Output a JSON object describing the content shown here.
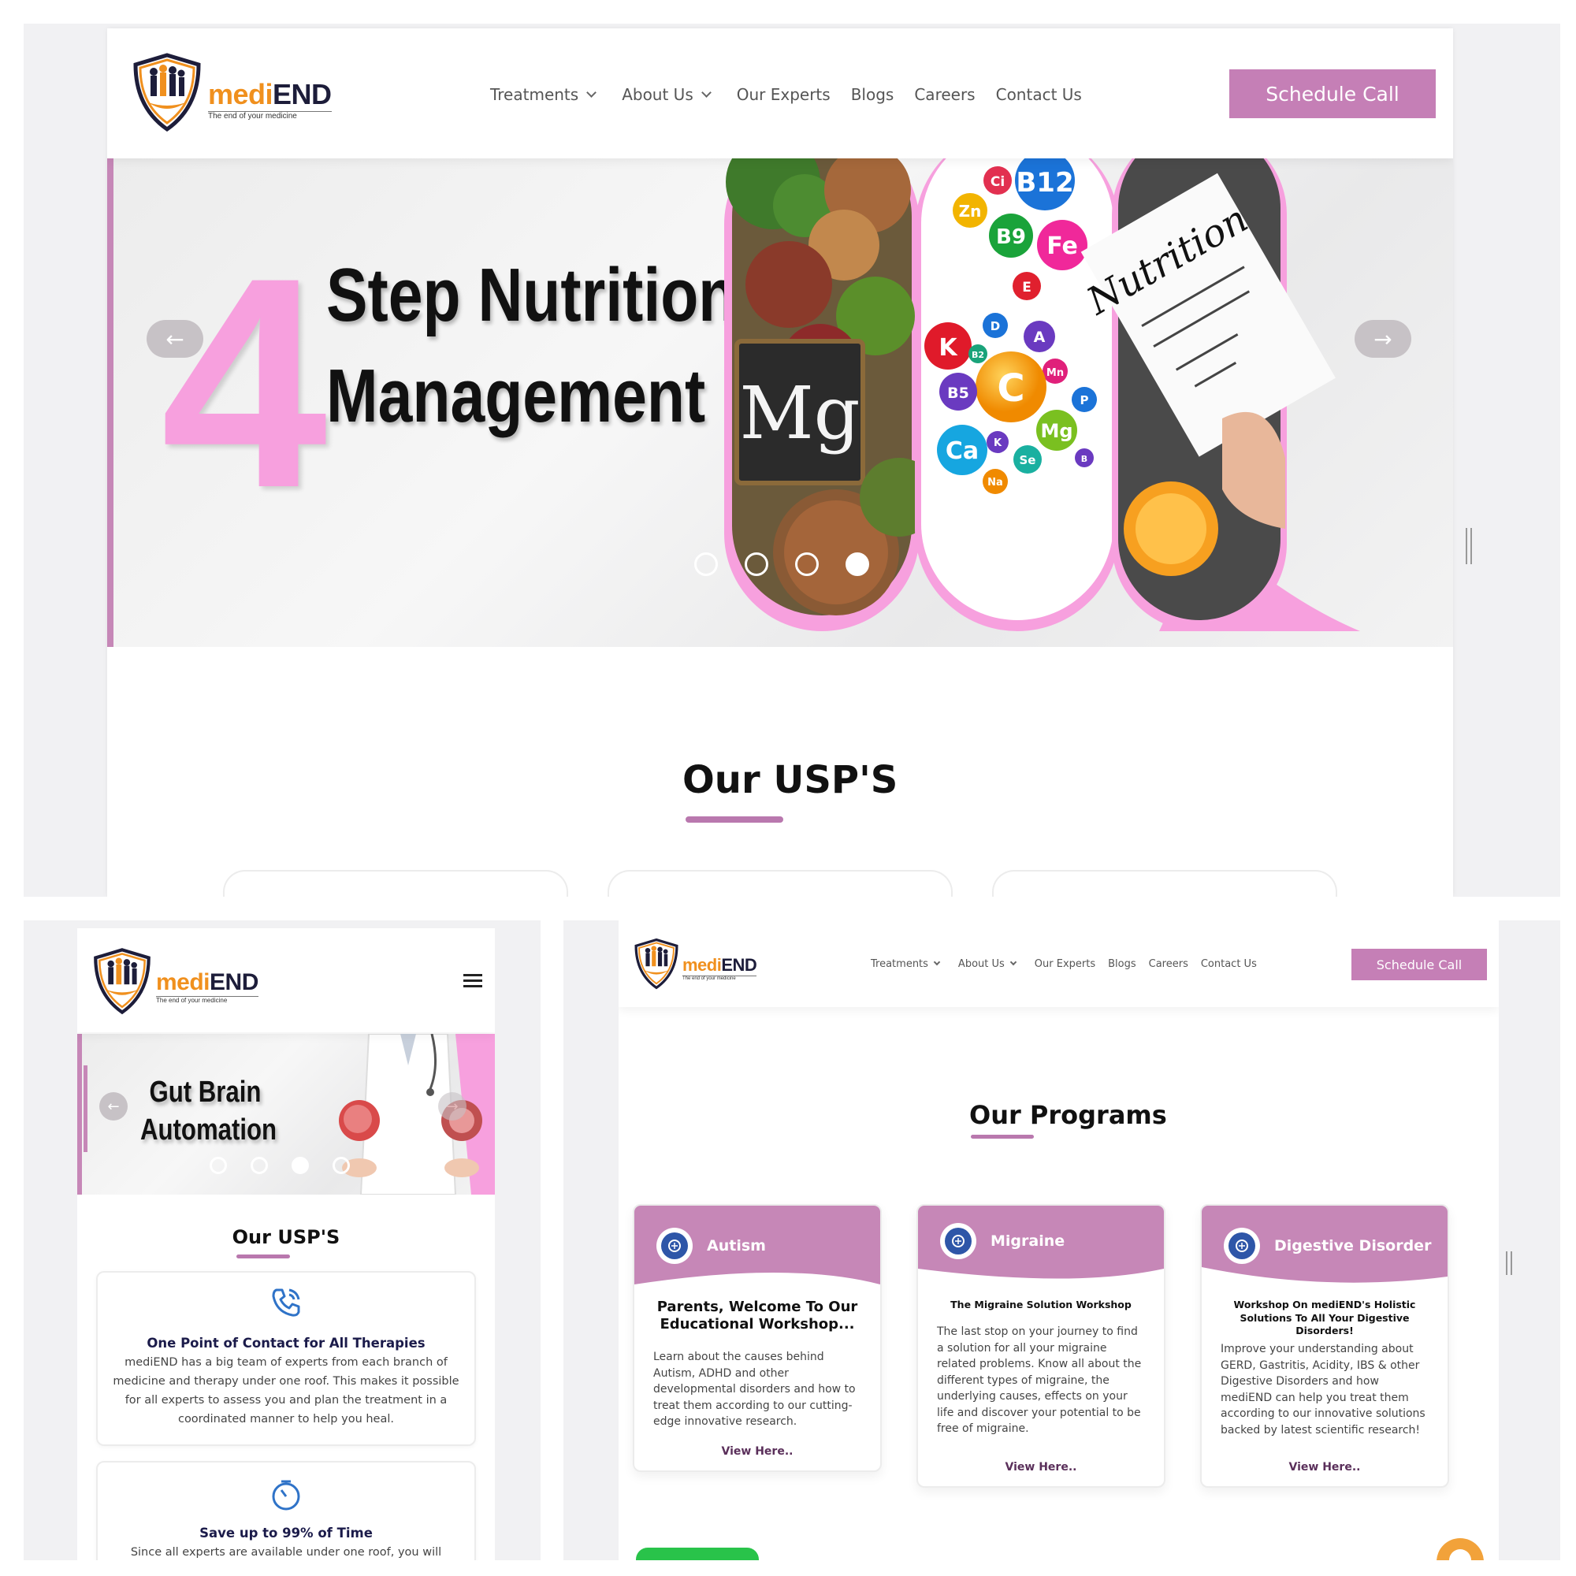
{
  "brand": {
    "medi": "medi",
    "end": "END",
    "tagline": "The end of your medicine"
  },
  "nav": {
    "items": [
      {
        "label": "Treatments",
        "dropdown": true
      },
      {
        "label": "About Us",
        "dropdown": true
      },
      {
        "label": "Our Experts",
        "dropdown": false
      },
      {
        "label": "Blogs",
        "dropdown": false
      },
      {
        "label": "Careers",
        "dropdown": false
      },
      {
        "label": "Contact Us",
        "dropdown": false
      }
    ],
    "cta": "Schedule Call"
  },
  "desktop_hero": {
    "number": "4",
    "title_line1": "Step Nutrition",
    "title_line2": "Management",
    "prev_arrow": "←",
    "next_arrow": "→",
    "slide_count": 4,
    "active_slide": 4,
    "image_text": {
      "chalkboard": "Mg",
      "note": "Nutrition",
      "vitamins": [
        "B12",
        "Ci",
        "Zn",
        "B9",
        "Fe",
        "E",
        "K",
        "D",
        "A",
        "B2",
        "Mn",
        "C",
        "B5",
        "P",
        "Mg",
        "Ca",
        "K",
        "Se",
        "Na",
        "B"
      ]
    }
  },
  "usp_section": {
    "title": "Our USP'S"
  },
  "mobile": {
    "hero_line1": "Gut Brain",
    "hero_line2": "Automation",
    "prev_arrow": "←",
    "next_arrow": "→",
    "slide_count": 4,
    "active_slide": 3,
    "usp_title": "Our USP'S",
    "usps": [
      {
        "icon": "phone-call-icon",
        "title": "One Point of Contact for All Therapies",
        "text": "mediEND has a big team of experts from each branch of medicine and therapy under one roof. This makes it possible for all experts to assess you and plan the treatment in a coordinated manner to help you heal."
      },
      {
        "icon": "timer-icon",
        "title": "Save up to 99% of Time",
        "text": "Since all experts are available under one roof, you will"
      }
    ]
  },
  "programs": {
    "title": "Our Programs",
    "cards": [
      {
        "name": "Autism",
        "subtitle": "Parents, Welcome To Our Educational Workshop...",
        "body": "Learn about the causes behind Autism, ADHD and other developmental disorders and how to treat them according to our cutting-edge innovative research.",
        "link": "View Here.."
      },
      {
        "name": "Migraine",
        "subtitle": "The Migraine Solution Workshop",
        "body": "The last stop on your journey to find a solution for all your migraine related problems. Know all about the different types of migraine, the underlying causes, effects on your life and discover your potential to be free of migraine.",
        "link": "View Here.."
      },
      {
        "name": "Digestive Disorder",
        "subtitle": "Workshop On mediEND's Holistic Solutions To All Your Digestive Disorders!",
        "body": "Improve your understanding about GERD, Gastritis, Acidity, IBS & other Digestive Disorders and how mediEND can help you treat them according to our innovative solutions backed by latest scientific research!",
        "link": "View Here.."
      }
    ]
  },
  "colors": {
    "accent": "#c57fb6",
    "hero_pink": "#f7a0de",
    "band": "#c687b7",
    "icon_blue": "#2e56a8",
    "logo_orange": "#f0901e",
    "logo_navy": "#1d1d3a"
  }
}
